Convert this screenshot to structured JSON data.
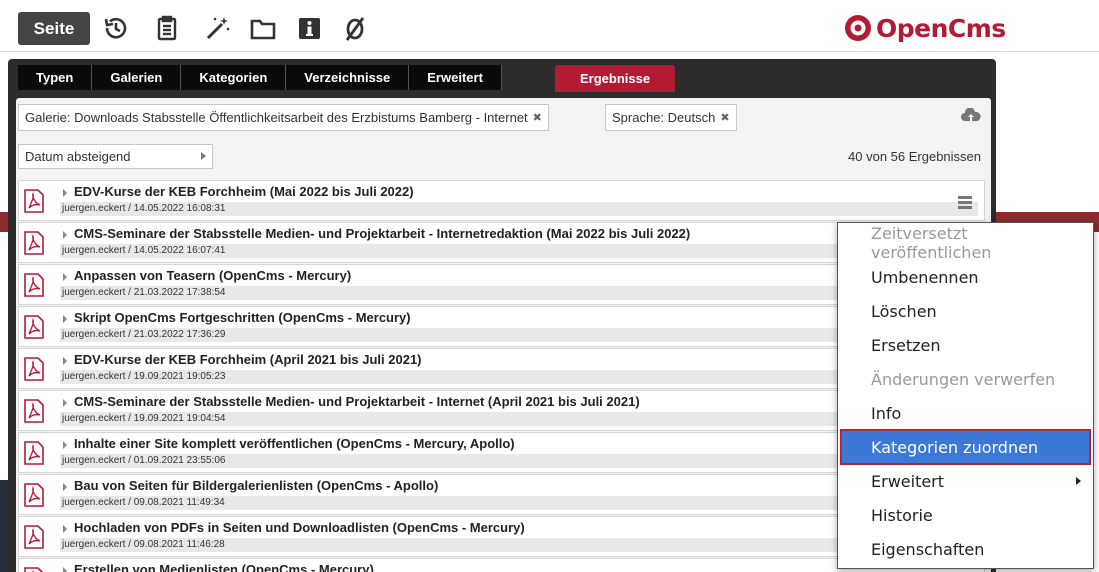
{
  "toolbar": {
    "seite_label": "Seite",
    "icons": [
      "history-icon",
      "clipboard-icon",
      "magic-wand-icon",
      "folder-icon",
      "info-icon",
      "null-icon"
    ],
    "logo_text": "OpenCms"
  },
  "tabs": [
    "Typen",
    "Galerien",
    "Kategorien",
    "Verzeichnisse",
    "Erweitert"
  ],
  "active_tab": "Ergebnisse",
  "filters": [
    "Galerie: Downloads Stabsstelle Öffentlichkeitsarbeit des Erzbistums Bamberg - Internet",
    "Sprache: Deutsch"
  ],
  "sort": {
    "value": "Datum absteigend"
  },
  "result_count": "40 von 56 Ergebnissen",
  "results": [
    {
      "title": "EDV-Kurse der KEB Forchheim (Mai 2022 bis Juli 2022)",
      "meta": "juergen.eckert / 14.05.2022 16:08:31"
    },
    {
      "title": "CMS-Seminare der Stabsstelle Medien- und Projektarbeit - Internetredaktion (Mai 2022 bis Juli 2022)",
      "meta": "juergen.eckert / 14.05.2022 16:07:41"
    },
    {
      "title": "Anpassen von Teasern (OpenCms - Mercury)",
      "meta": "juergen.eckert / 21.03.2022 17:38:54"
    },
    {
      "title": "Skript OpenCms Fortgeschritten (OpenCms - Mercury)",
      "meta": "juergen.eckert / 21.03.2022 17:36:29"
    },
    {
      "title": "EDV-Kurse der KEB Forchheim (April 2021 bis Juli 2021)",
      "meta": "juergen.eckert / 19.09.2021 19:05:23"
    },
    {
      "title": "CMS-Seminare der Stabsstelle Medien- und Projektarbeit - Internet (April 2021 bis Juli 2021)",
      "meta": "juergen.eckert / 19.09.2021 19:04:54"
    },
    {
      "title": "Inhalte einer Site komplett veröffentlichen (OpenCms - Mercury, Apollo)",
      "meta": "juergen.eckert / 01.09.2021 23:55:06"
    },
    {
      "title": "Bau von Seiten für Bildergalerienlisten (OpenCms - Apollo)",
      "meta": "juergen.eckert / 09.08.2021 11:49:34"
    },
    {
      "title": "Hochladen von PDFs in Seiten und Downloadlisten (OpenCms - Mercury)",
      "meta": "juergen.eckert / 09.08.2021 11:46:28"
    },
    {
      "title": "Erstellen von Medienlisten (OpenCms - Mercury)",
      "meta": ""
    }
  ],
  "context_menu": [
    {
      "label": "Zeitversetzt veröffentlichen",
      "state": "disabled"
    },
    {
      "label": "Umbenennen",
      "state": "normal"
    },
    {
      "label": "Löschen",
      "state": "normal"
    },
    {
      "label": "Ersetzen",
      "state": "normal"
    },
    {
      "label": "Änderungen verwerfen",
      "state": "disabled"
    },
    {
      "label": "Info",
      "state": "normal"
    },
    {
      "label": "Kategorien zuordnen",
      "state": "selected"
    },
    {
      "label": "Erweitert",
      "state": "submenu"
    },
    {
      "label": "Historie",
      "state": "normal"
    },
    {
      "label": "Eigenschaften",
      "state": "normal"
    }
  ],
  "colors": {
    "accent": "#b31b34",
    "selection": "#3c78d8",
    "dialog_bg": "#2c2c2c"
  }
}
